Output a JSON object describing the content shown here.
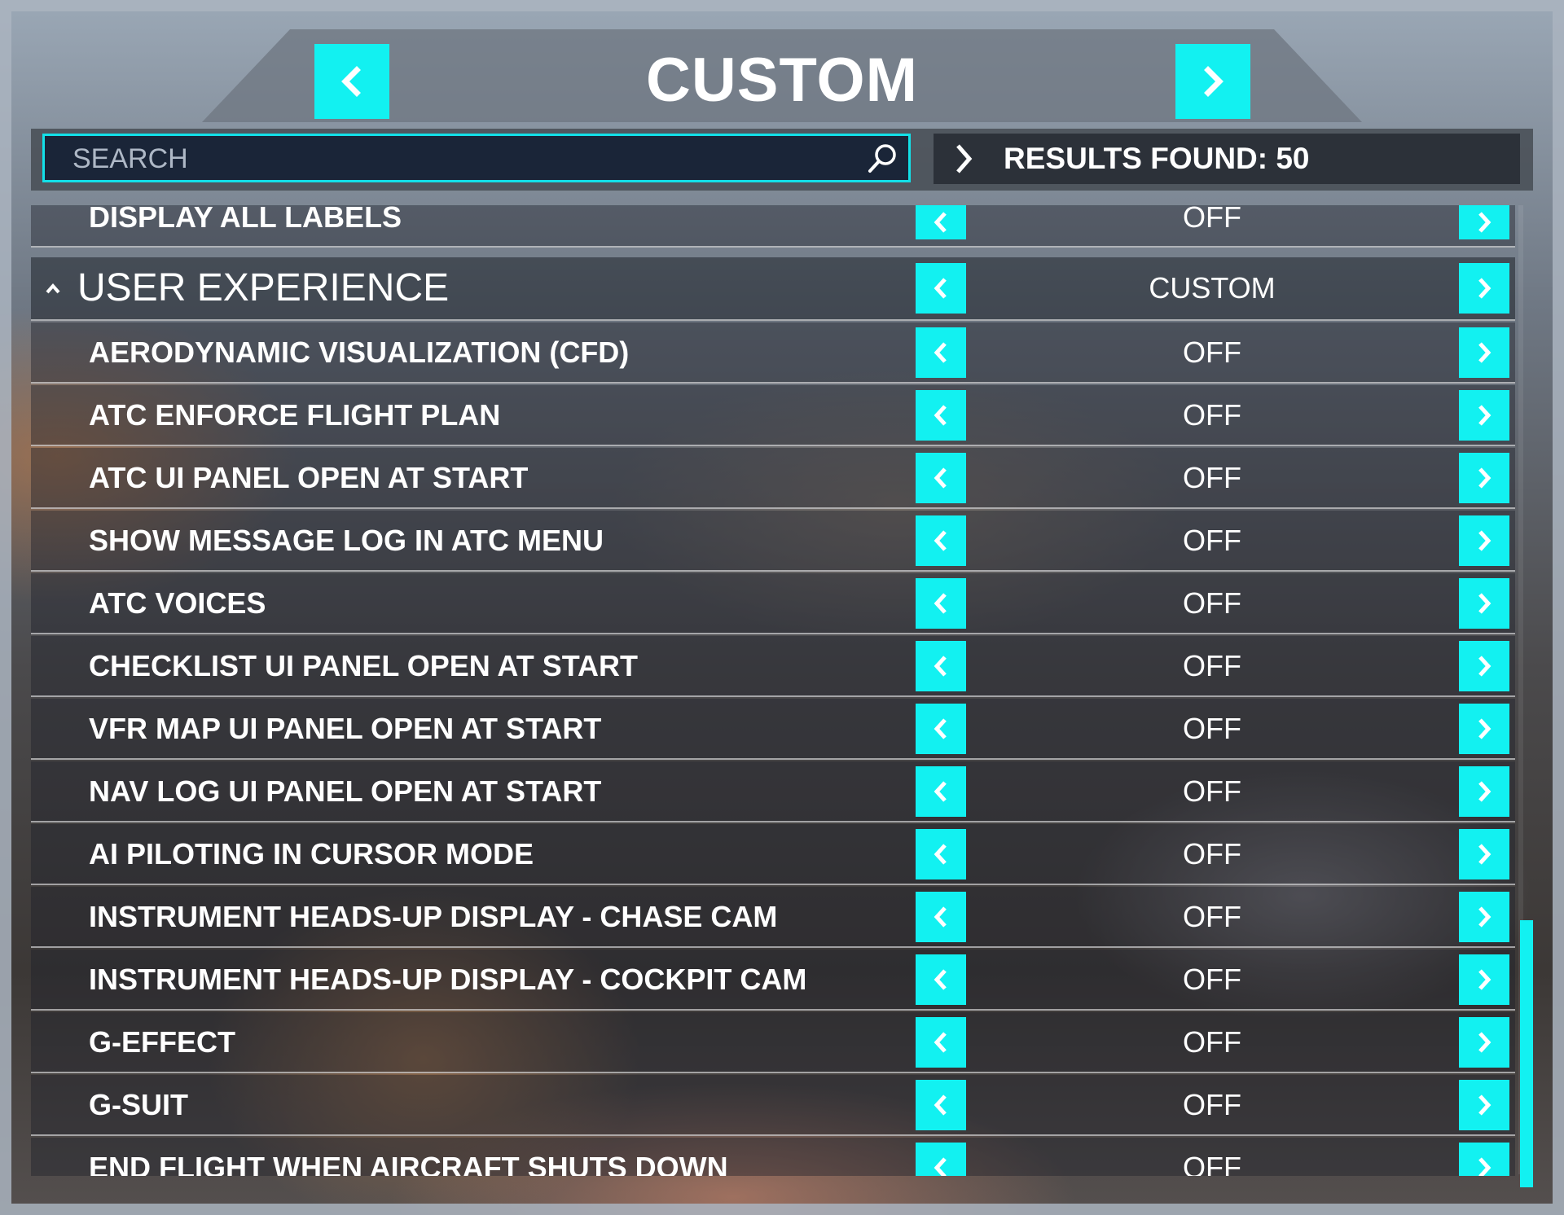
{
  "header": {
    "title": "CUSTOM",
    "prev_icon": "chevron-left-icon",
    "next_icon": "chevron-right-icon"
  },
  "search": {
    "placeholder": "SEARCH",
    "value": "",
    "icon": "search-icon"
  },
  "results": {
    "text": "RESULTS FOUND: 50",
    "icon": "chevron-right-icon"
  },
  "colors": {
    "accent": "#12f1f1",
    "search_border": "#12e0e8"
  },
  "settings": {
    "partial_row": {
      "label": "DISPLAY ALL LABELS",
      "value": "OFF"
    },
    "section": {
      "label": "USER EXPERIENCE",
      "value": "CUSTOM",
      "icon": "caret-up-icon"
    },
    "rows": [
      {
        "label": "AERODYNAMIC VISUALIZATION (CFD)",
        "value": "OFF"
      },
      {
        "label": "ATC ENFORCE FLIGHT PLAN",
        "value": "OFF"
      },
      {
        "label": "ATC UI PANEL OPEN AT START",
        "value": "OFF"
      },
      {
        "label": "SHOW MESSAGE LOG IN ATC MENU",
        "value": "OFF"
      },
      {
        "label": "ATC VOICES",
        "value": "OFF"
      },
      {
        "label": "CHECKLIST UI PANEL OPEN AT START",
        "value": "OFF"
      },
      {
        "label": "VFR MAP UI PANEL OPEN AT START",
        "value": "OFF"
      },
      {
        "label": "NAV LOG UI PANEL OPEN AT START",
        "value": "OFF"
      },
      {
        "label": "AI PILOTING IN CURSOR MODE",
        "value": "OFF"
      },
      {
        "label": "INSTRUMENT HEADS-UP DISPLAY - CHASE CAM",
        "value": "OFF"
      },
      {
        "label": "INSTRUMENT HEADS-UP DISPLAY - COCKPIT CAM",
        "value": "OFF"
      },
      {
        "label": "G-EFFECT",
        "value": "OFF"
      },
      {
        "label": "G-SUIT",
        "value": "OFF"
      },
      {
        "label": "END FLIGHT WHEN AIRCRAFT SHUTS DOWN",
        "value": "OFF"
      }
    ]
  }
}
